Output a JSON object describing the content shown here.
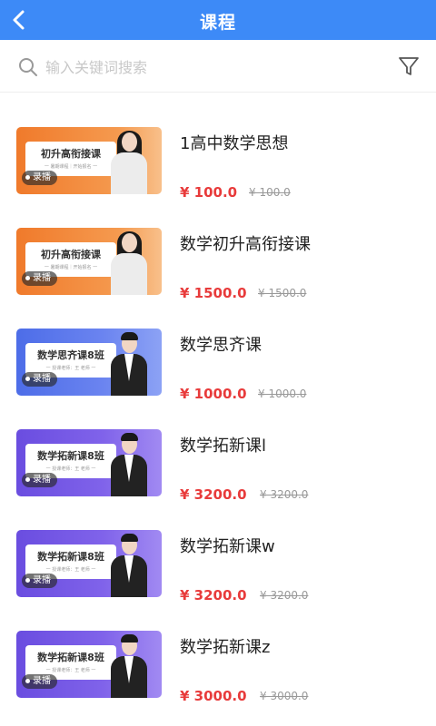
{
  "header": {
    "title": "课程",
    "back_icon": "chevron-left-icon"
  },
  "search": {
    "placeholder": "输入关键词搜索",
    "value": "",
    "icon": "search-icon",
    "filter_icon": "funnel-icon"
  },
  "colors": {
    "primary": "#3d8af7",
    "price": "#e83b3b",
    "original_price": "#999999"
  },
  "courses": [
    {
      "name": "1高中数学思想",
      "price": "¥ 100.0",
      "original_price": "¥ 100.0",
      "thumb_title": "初升高衔接课",
      "thumb_sub": "一 暑期课程｜开始报名 一",
      "badge": "录播"
    },
    {
      "name": "数学初升高衔接课",
      "price": "¥ 1500.0",
      "original_price": "¥ 1500.0",
      "thumb_title": "初升高衔接课",
      "thumb_sub": "一 暑期课程｜开始报名 一",
      "badge": "录播"
    },
    {
      "name": "数学思齐课",
      "price": "¥ 1000.0",
      "original_price": "¥ 1000.0",
      "thumb_title": "数学思齐课8班",
      "thumb_sub": "一 授课老师：王 老师 一",
      "badge": "录播"
    },
    {
      "name": "数学拓新课l",
      "price": "¥ 3200.0",
      "original_price": "¥ 3200.0",
      "thumb_title": "数学拓新课8班",
      "thumb_sub": "一 授课老师：王 老师 一",
      "badge": "录播"
    },
    {
      "name": "数学拓新课w",
      "price": "¥ 3200.0",
      "original_price": "¥ 3200.0",
      "thumb_title": "数学拓新课8班",
      "thumb_sub": "一 授课老师：王 老师 一",
      "badge": "录播"
    },
    {
      "name": "数学拓新课z",
      "price": "¥ 3000.0",
      "original_price": "¥ 3000.0",
      "thumb_title": "数学拓新课8班",
      "thumb_sub": "一 授课老师：王 老师 一",
      "badge": "录播"
    }
  ]
}
